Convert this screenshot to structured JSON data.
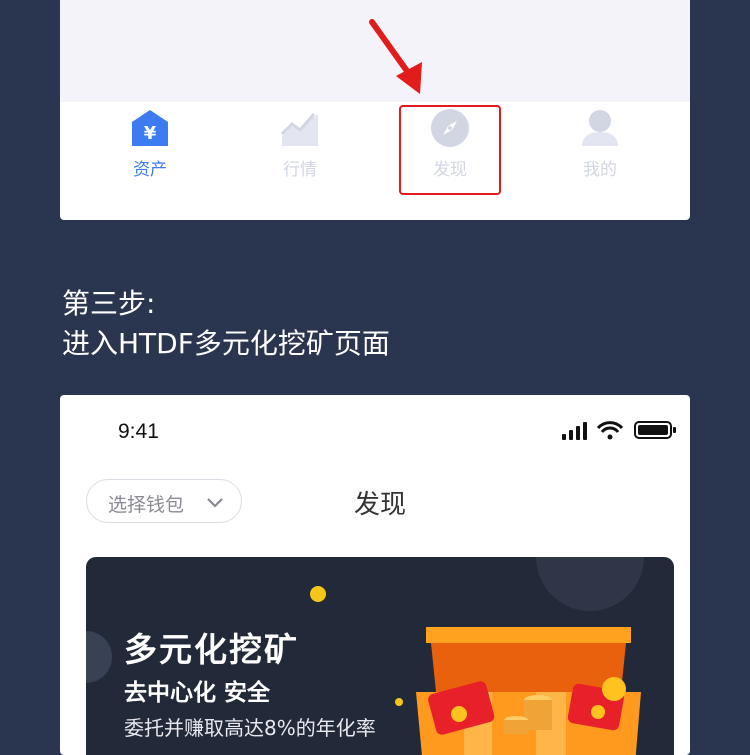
{
  "tabbar": {
    "tabs": [
      {
        "label": "资产",
        "icon": "wallet-yen-icon",
        "active": true
      },
      {
        "label": "行情",
        "icon": "market-chart-icon",
        "active": false
      },
      {
        "label": "发现",
        "icon": "compass-icon",
        "active": false
      },
      {
        "label": "我的",
        "icon": "user-icon",
        "active": false
      }
    ],
    "highlighted_tab": "发现"
  },
  "step": {
    "line1": "第三步:",
    "line2": "进入HTDF多元化挖矿页面"
  },
  "phone": {
    "time": "9:41",
    "wallet_select": "选择钱包",
    "title": "发现"
  },
  "banner": {
    "title": "多元化挖矿",
    "subtitle": "去中心化 安全",
    "description": "委托并赚取高达8%的年化率"
  },
  "colors": {
    "page_bg": "#2a3550",
    "accent": "#3d7bf0",
    "highlight": "#e21b1b",
    "banner_bg": "#222a3a"
  }
}
